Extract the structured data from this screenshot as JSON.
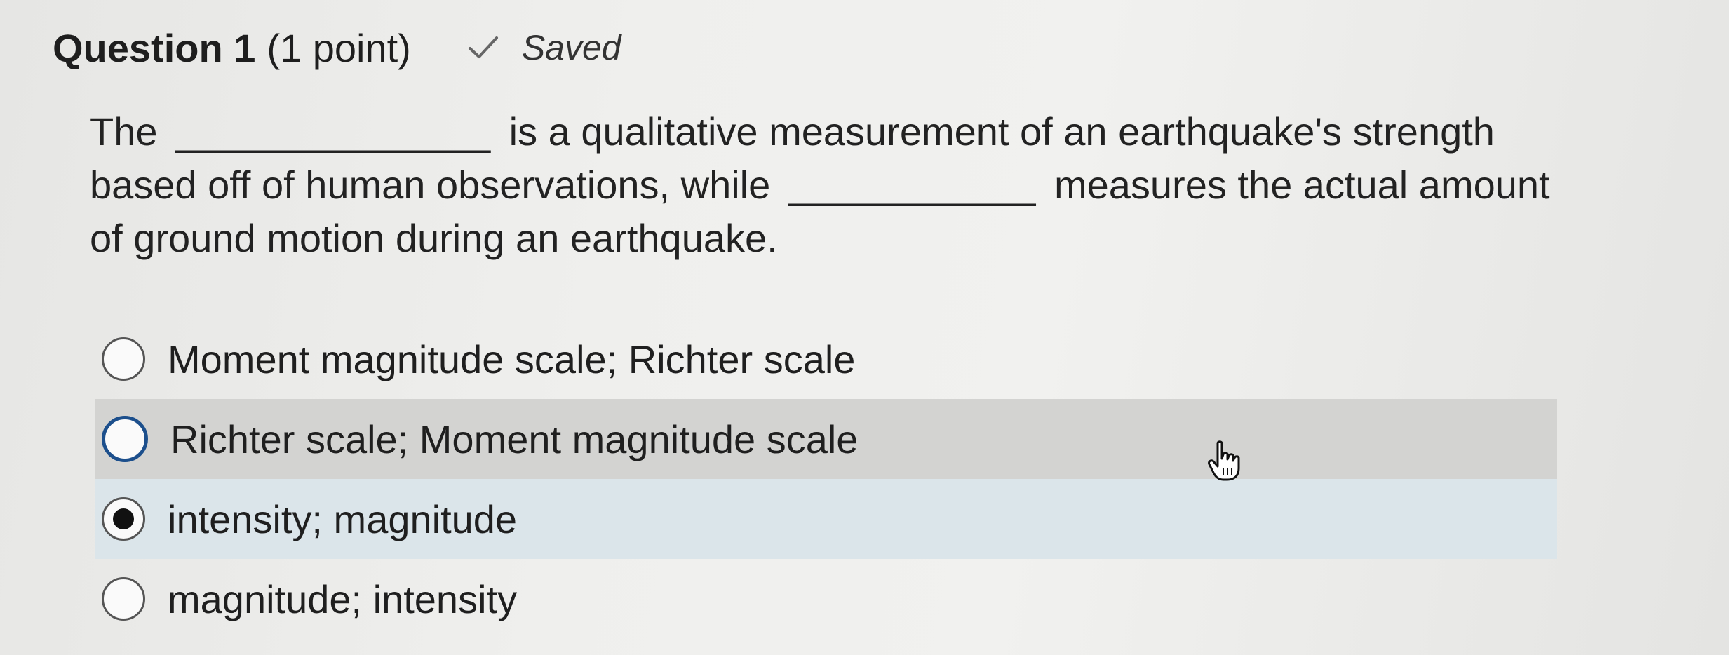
{
  "header": {
    "title": "Question 1",
    "points": "(1 point)",
    "status": "Saved",
    "status_icon": "checkmark-icon"
  },
  "question": {
    "part1": "The",
    "blank1": "______________",
    "part2": "is a qualitative measurement of an earthquake's strength based off of human observations, while",
    "blank2": "___________",
    "part3": "measures the actual amount of ground motion during an earthquake."
  },
  "options": [
    {
      "label": "Moment magnitude scale; Richter scale",
      "selected": false
    },
    {
      "label": "Richter scale; Moment magnitude scale",
      "selected": false
    },
    {
      "label": "intensity; magnitude",
      "selected": true
    },
    {
      "label": "magnitude; intensity",
      "selected": false
    }
  ],
  "colors": {
    "hover_row": "#d3d3d1",
    "selected_row": "#dbe5ea",
    "focus_ring": "#1c4f8c"
  }
}
